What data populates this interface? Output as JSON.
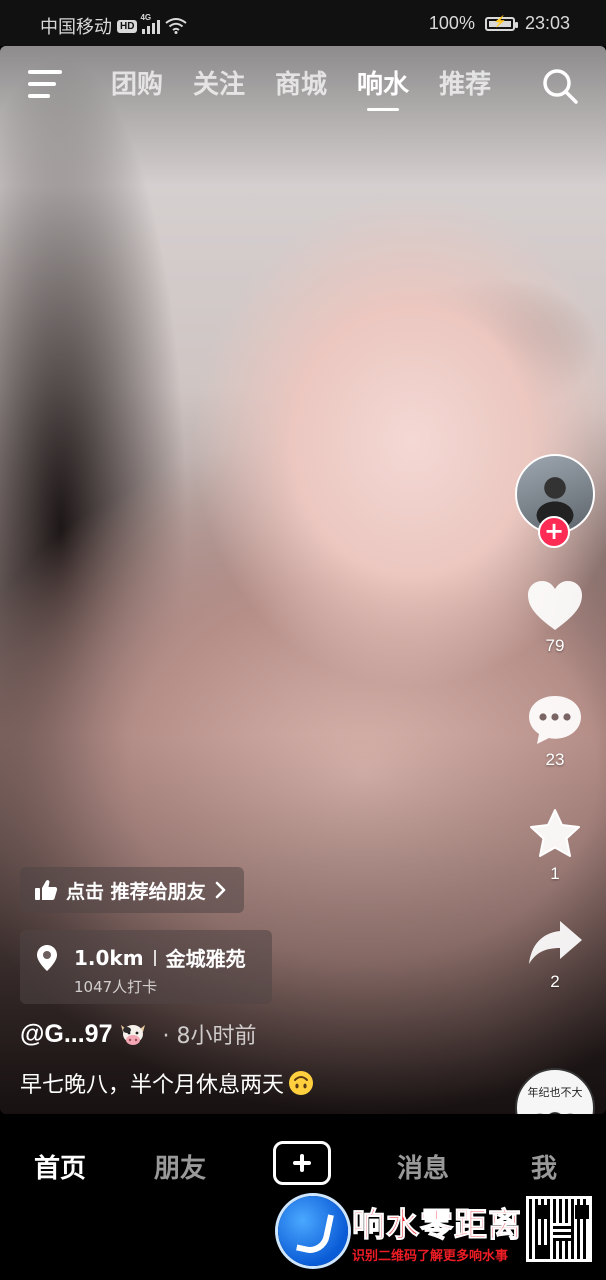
{
  "status_bar": {
    "carrier": "中国移动",
    "hd": "HD",
    "network": "4G",
    "battery": "100%",
    "battery_level": 1.0,
    "time": "23:03"
  },
  "top_nav": {
    "tabs": [
      {
        "label": "团购",
        "active": false
      },
      {
        "label": "关注",
        "active": false
      },
      {
        "label": "商城",
        "active": false
      },
      {
        "label": "响水",
        "active": true
      },
      {
        "label": "推荐",
        "active": false
      }
    ]
  },
  "actions": {
    "likes": "79",
    "comments": "23",
    "favorites": "1",
    "shares": "2"
  },
  "music_disc": {
    "caption": "年纪也不大"
  },
  "recommend": {
    "label": "点击 推荐给朋友"
  },
  "location": {
    "distance": "1.0km",
    "name": "金城雅苑",
    "checkins": "1047人打卡"
  },
  "post": {
    "author": "@G...97",
    "time_ago": "· 8小时前",
    "caption": "早七晚八，半个月休息两天"
  },
  "bottom_nav": {
    "home": "首页",
    "friends": "朋友",
    "messages": "消息",
    "me": "我"
  },
  "watermark": {
    "title": "响水零距离",
    "subtitle": "识别二维码了解更多响水事"
  },
  "colors": {
    "accent": "#fe2c55",
    "watermark_red": "#ee1c25",
    "watermark_blue": "#0a5bd6"
  }
}
